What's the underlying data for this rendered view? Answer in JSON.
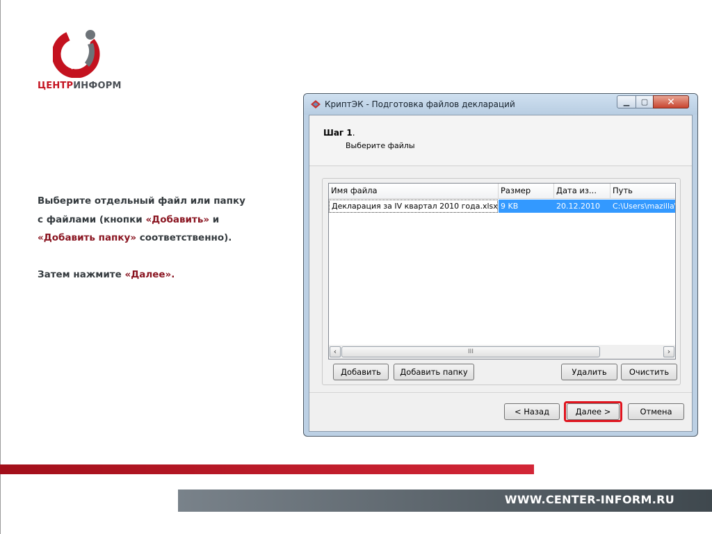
{
  "brand": {
    "logo_part1": "ЦЕНТР",
    "logo_part2": "ИНФОРМ",
    "site": "WWW.CENTER-INFORM.RU",
    "colors": {
      "red": "#c4121f",
      "gray": "#4a4f55"
    }
  },
  "instructions": {
    "line1": "Выберите отдельный файл или папку",
    "line2_a": "с файлами (кнопки ",
    "line2_b": "«Добавить»",
    "line2_c": " и",
    "line3_a": "«Добавить папку»",
    "line3_b": " соответственно).",
    "line4_a": "Затем нажмите ",
    "line4_b": "«Далее»",
    "line4_c": "."
  },
  "window": {
    "title": "КриптЭК - Подготовка файлов деклараций",
    "step_label": "Шаг 1",
    "step_dot": ".",
    "step_subtitle": "Выберите файлы",
    "columns": [
      "Имя файла",
      "Размер",
      "Дата из...",
      "Путь"
    ],
    "rows": [
      [
        "Декларация за IV квартал 2010 года.xlsx",
        "9 KB",
        "20.12.2010",
        "C:\\Users\\mazilla\\D"
      ]
    ],
    "scroll_thumb": "III",
    "buttons": {
      "add": "Добавить",
      "add_folder": "Добавить папку",
      "delete": "Удалить",
      "clear": "Очистить",
      "back": "< Назад",
      "next": "Далее >",
      "cancel": "Отмена"
    }
  }
}
